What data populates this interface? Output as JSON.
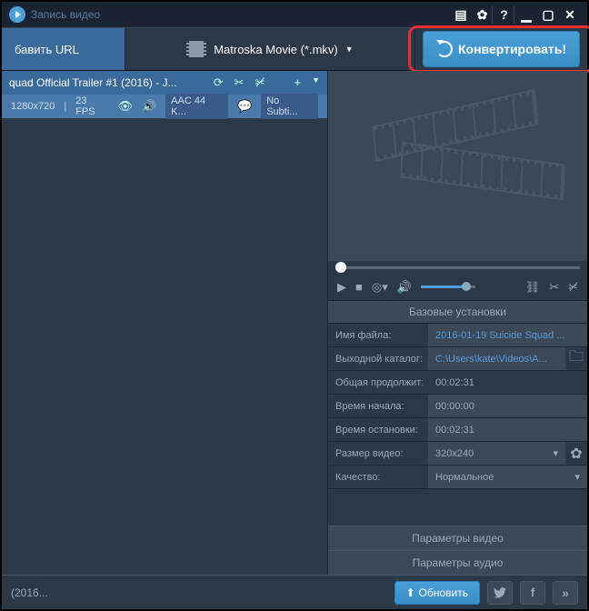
{
  "titlebar": {
    "title": "Запись видео"
  },
  "toolbar": {
    "add_url": "бавить URL",
    "format": "Matroska Movie (*.mkv)",
    "convert": "Конвертировать!"
  },
  "file": {
    "name": "quad Official Trailer #1 (2016) - J...",
    "resolution": "1280x720",
    "fps": "23 FPS",
    "audio": "AAC 44 K...",
    "subtitle": "No Subti..."
  },
  "settings": {
    "header": "Базовые установки",
    "rows": {
      "filename_label": "Имя файла:",
      "filename_value": "2016-01-19 Suicide Squad ...",
      "output_label": "Выходной каталог:",
      "output_value": "C:\\Users\\kate\\Videos\\A...",
      "duration_label": "Общая продолжит:",
      "duration_value": "00:02:31",
      "start_label": "Время начала:",
      "start_value": "00:00:00",
      "stop_label": "Время остановки:",
      "stop_value": "00:02:31",
      "size_label": "Размер видео:",
      "size_value": "320x240",
      "quality_label": "Качество:",
      "quality_value": "Нормальное"
    },
    "video_params": "Параметры видео",
    "audio_params": "Параметры аудио"
  },
  "bottom": {
    "status": "(2016...",
    "update": "Обновить"
  }
}
